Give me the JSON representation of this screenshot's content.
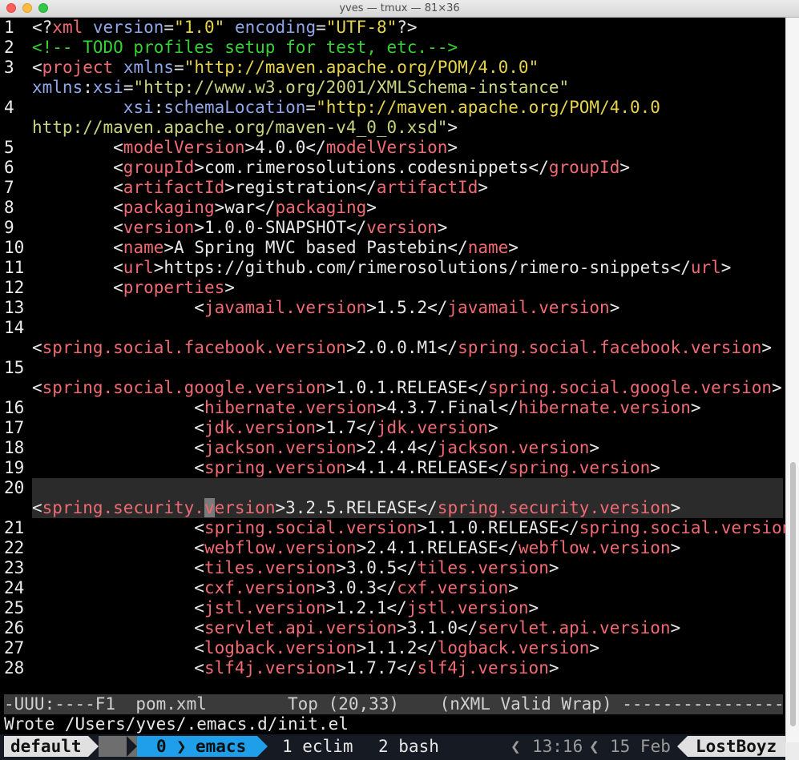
{
  "window": {
    "title": "yves — tmux — 81×36"
  },
  "editor": {
    "rows": [
      {
        "ln": "1",
        "tokens": [
          [
            "punct",
            "<?"
          ],
          [
            "pi",
            "xml"
          ],
          [
            "punct",
            " "
          ],
          [
            "attr",
            "version"
          ],
          [
            "punct",
            "="
          ],
          [
            "str",
            "\"1.0\""
          ],
          [
            "punct",
            " "
          ],
          [
            "attr",
            "encoding"
          ],
          [
            "punct",
            "="
          ],
          [
            "str",
            "\"UTF-8\""
          ],
          [
            "punct",
            "?>"
          ]
        ]
      },
      {
        "ln": "2",
        "tokens": [
          [
            "comment",
            "<!-- TODO profiles setup for test, etc.-->"
          ]
        ]
      },
      {
        "ln": "3",
        "tokens": [
          [
            "punct",
            "<"
          ],
          [
            "tag",
            "project"
          ],
          [
            "punct",
            " "
          ],
          [
            "attr",
            "xmlns"
          ],
          [
            "punct",
            "="
          ],
          [
            "str",
            "\"http://maven.apache.org/POM/4.0.0\""
          ]
        ]
      },
      {
        "ln": "",
        "tokens": [
          [
            "attr",
            "xmlns"
          ],
          [
            "punct",
            ":"
          ],
          [
            "attr",
            "xsi"
          ],
          [
            "punct",
            "="
          ],
          [
            "strg",
            "\"http://www.w3.org/2001/XMLSchema-instance\""
          ]
        ]
      },
      {
        "ln": "4",
        "tokens": [
          [
            "punct",
            "         "
          ],
          [
            "attr",
            "xsi"
          ],
          [
            "punct",
            ":"
          ],
          [
            "attr",
            "schemaLocation"
          ],
          [
            "punct",
            "="
          ],
          [
            "str",
            "\"http://maven.apache.org/POM/4.0.0"
          ]
        ]
      },
      {
        "ln": "",
        "tokens": [
          [
            "strg",
            "http://maven.apache.org/maven-v4_0_0.xsd\""
          ],
          [
            "punct",
            ">"
          ]
        ]
      },
      {
        "ln": "5",
        "tokens": [
          [
            "punct",
            "        <"
          ],
          [
            "tag",
            "modelVersion"
          ],
          [
            "punct",
            ">"
          ],
          [
            "text",
            "4.0.0"
          ],
          [
            "punct",
            "</"
          ],
          [
            "tag",
            "modelVersion"
          ],
          [
            "punct",
            ">"
          ]
        ]
      },
      {
        "ln": "6",
        "tokens": [
          [
            "punct",
            "        <"
          ],
          [
            "tag",
            "groupId"
          ],
          [
            "punct",
            ">"
          ],
          [
            "text",
            "com.rimerosolutions.codesnippets"
          ],
          [
            "punct",
            "</"
          ],
          [
            "tag",
            "groupId"
          ],
          [
            "punct",
            ">"
          ]
        ]
      },
      {
        "ln": "7",
        "tokens": [
          [
            "punct",
            "        <"
          ],
          [
            "tag",
            "artifactId"
          ],
          [
            "punct",
            ">"
          ],
          [
            "text",
            "registration"
          ],
          [
            "punct",
            "</"
          ],
          [
            "tag",
            "artifactId"
          ],
          [
            "punct",
            ">"
          ]
        ]
      },
      {
        "ln": "8",
        "tokens": [
          [
            "punct",
            "        <"
          ],
          [
            "tag",
            "packaging"
          ],
          [
            "punct",
            ">"
          ],
          [
            "text",
            "war"
          ],
          [
            "punct",
            "</"
          ],
          [
            "tag",
            "packaging"
          ],
          [
            "punct",
            ">"
          ]
        ]
      },
      {
        "ln": "9",
        "tokens": [
          [
            "punct",
            "        <"
          ],
          [
            "tag",
            "version"
          ],
          [
            "punct",
            ">"
          ],
          [
            "text",
            "1.0.0-SNAPSHOT"
          ],
          [
            "punct",
            "</"
          ],
          [
            "tag",
            "version"
          ],
          [
            "punct",
            ">"
          ]
        ]
      },
      {
        "ln": "10",
        "tokens": [
          [
            "punct",
            "        <"
          ],
          [
            "tag",
            "name"
          ],
          [
            "punct",
            ">"
          ],
          [
            "text",
            "A Spring MVC based Pastebin"
          ],
          [
            "punct",
            "</"
          ],
          [
            "tag",
            "name"
          ],
          [
            "punct",
            ">"
          ]
        ]
      },
      {
        "ln": "11",
        "tokens": [
          [
            "punct",
            "        <"
          ],
          [
            "tag",
            "url"
          ],
          [
            "punct",
            ">"
          ],
          [
            "text",
            "https://github.com/rimerosolutions/rimero-snippets"
          ],
          [
            "punct",
            "</"
          ],
          [
            "tag",
            "url"
          ],
          [
            "punct",
            ">"
          ]
        ]
      },
      {
        "ln": "12",
        "tokens": [
          [
            "punct",
            "        <"
          ],
          [
            "tag",
            "properties"
          ],
          [
            "punct",
            ">"
          ]
        ]
      },
      {
        "ln": "13",
        "tokens": [
          [
            "punct",
            "                <"
          ],
          [
            "tag",
            "javamail.version"
          ],
          [
            "punct",
            ">"
          ],
          [
            "text",
            "1.5.2"
          ],
          [
            "punct",
            "</"
          ],
          [
            "tag",
            "javamail.version"
          ],
          [
            "punct",
            ">"
          ]
        ]
      },
      {
        "ln": "14",
        "tokens": []
      },
      {
        "ln": "",
        "tokens": [
          [
            "punct",
            "<"
          ],
          [
            "tag",
            "spring.social.facebook.version"
          ],
          [
            "punct",
            ">"
          ],
          [
            "text",
            "2.0.0.M1"
          ],
          [
            "punct",
            "</"
          ],
          [
            "tag",
            "spring.social.facebook.version"
          ],
          [
            "punct",
            ">"
          ]
        ]
      },
      {
        "ln": "15",
        "tokens": []
      },
      {
        "ln": "",
        "tokens": [
          [
            "punct",
            "<"
          ],
          [
            "tag",
            "spring.social.google.version"
          ],
          [
            "punct",
            ">"
          ],
          [
            "text",
            "1.0.1.RELEASE"
          ],
          [
            "punct",
            "</"
          ],
          [
            "tag",
            "spring.social.google.version"
          ],
          [
            "punct",
            ">"
          ]
        ]
      },
      {
        "ln": "16",
        "tokens": [
          [
            "punct",
            "                <"
          ],
          [
            "tag",
            "hibernate.version"
          ],
          [
            "punct",
            ">"
          ],
          [
            "text",
            "4.3.7.Final"
          ],
          [
            "punct",
            "</"
          ],
          [
            "tag",
            "hibernate.version"
          ],
          [
            "punct",
            ">"
          ]
        ]
      },
      {
        "ln": "17",
        "tokens": [
          [
            "punct",
            "                <"
          ],
          [
            "tag",
            "jdk.version"
          ],
          [
            "punct",
            ">"
          ],
          [
            "text",
            "1.7"
          ],
          [
            "punct",
            "</"
          ],
          [
            "tag",
            "jdk.version"
          ],
          [
            "punct",
            ">"
          ]
        ]
      },
      {
        "ln": "18",
        "tokens": [
          [
            "punct",
            "                <"
          ],
          [
            "tag",
            "jackson.version"
          ],
          [
            "punct",
            ">"
          ],
          [
            "text",
            "2.4.4"
          ],
          [
            "punct",
            "</"
          ],
          [
            "tag",
            "jackson.version"
          ],
          [
            "punct",
            ">"
          ]
        ]
      },
      {
        "ln": "19",
        "tokens": [
          [
            "punct",
            "                <"
          ],
          [
            "tag",
            "spring.version"
          ],
          [
            "punct",
            ">"
          ],
          [
            "text",
            "4.1.4.RELEASE"
          ],
          [
            "punct",
            "</"
          ],
          [
            "tag",
            "spring.version"
          ],
          [
            "punct",
            ">"
          ]
        ]
      },
      {
        "ln": "20",
        "tokens": [],
        "current": true
      },
      {
        "ln": "",
        "tokens": [
          [
            "punct",
            "<"
          ],
          [
            "tag",
            "spring.security."
          ],
          [
            "cursor",
            "v"
          ],
          [
            "tag",
            "ersion"
          ],
          [
            "punct",
            ">"
          ],
          [
            "text",
            "3.2.5.RELEASE"
          ],
          [
            "punct",
            "</"
          ],
          [
            "tag",
            "spring.security.version"
          ],
          [
            "punct",
            ">"
          ]
        ],
        "current": true
      },
      {
        "ln": "21",
        "tokens": [
          [
            "punct",
            "                <"
          ],
          [
            "tag",
            "spring.social.version"
          ],
          [
            "punct",
            ">"
          ],
          [
            "text",
            "1.1.0.RELEASE"
          ],
          [
            "punct",
            "</"
          ],
          [
            "tag",
            "spring.social.version"
          ],
          [
            "punct",
            ">"
          ]
        ]
      },
      {
        "ln": "22",
        "tokens": [
          [
            "punct",
            "                <"
          ],
          [
            "tag",
            "webflow.version"
          ],
          [
            "punct",
            ">"
          ],
          [
            "text",
            "2.4.1.RELEASE"
          ],
          [
            "punct",
            "</"
          ],
          [
            "tag",
            "webflow.version"
          ],
          [
            "punct",
            ">"
          ]
        ]
      },
      {
        "ln": "23",
        "tokens": [
          [
            "punct",
            "                <"
          ],
          [
            "tag",
            "tiles.version"
          ],
          [
            "punct",
            ">"
          ],
          [
            "text",
            "3.0.5"
          ],
          [
            "punct",
            "</"
          ],
          [
            "tag",
            "tiles.version"
          ],
          [
            "punct",
            ">"
          ]
        ]
      },
      {
        "ln": "24",
        "tokens": [
          [
            "punct",
            "                <"
          ],
          [
            "tag",
            "cxf.version"
          ],
          [
            "punct",
            ">"
          ],
          [
            "text",
            "3.0.3"
          ],
          [
            "punct",
            "</"
          ],
          [
            "tag",
            "cxf.version"
          ],
          [
            "punct",
            ">"
          ]
        ]
      },
      {
        "ln": "25",
        "tokens": [
          [
            "punct",
            "                <"
          ],
          [
            "tag",
            "jstl.version"
          ],
          [
            "punct",
            ">"
          ],
          [
            "text",
            "1.2.1"
          ],
          [
            "punct",
            "</"
          ],
          [
            "tag",
            "jstl.version"
          ],
          [
            "punct",
            ">"
          ]
        ]
      },
      {
        "ln": "26",
        "tokens": [
          [
            "punct",
            "                <"
          ],
          [
            "tag",
            "servlet.api.version"
          ],
          [
            "punct",
            ">"
          ],
          [
            "text",
            "3.1.0"
          ],
          [
            "punct",
            "</"
          ],
          [
            "tag",
            "servlet.api.version"
          ],
          [
            "punct",
            ">"
          ]
        ]
      },
      {
        "ln": "27",
        "tokens": [
          [
            "punct",
            "                <"
          ],
          [
            "tag",
            "logback.version"
          ],
          [
            "punct",
            ">"
          ],
          [
            "text",
            "1.1.2"
          ],
          [
            "punct",
            "</"
          ],
          [
            "tag",
            "logback.version"
          ],
          [
            "punct",
            ">"
          ]
        ]
      },
      {
        "ln": "28",
        "tokens": [
          [
            "punct",
            "                <"
          ],
          [
            "tag",
            "slf4j.version"
          ],
          [
            "punct",
            ">"
          ],
          [
            "text",
            "1.7.7"
          ],
          [
            "punct",
            "</"
          ],
          [
            "tag",
            "slf4j.version"
          ],
          [
            "punct",
            ">"
          ]
        ]
      }
    ]
  },
  "modeline": {
    "text": "-UUU:----F1  pom.xml        Top (20,33)    (nXML Valid Wrap) ------------------------"
  },
  "minibuffer": {
    "text": "Wrote /Users/yves/.emacs.d/init.el"
  },
  "tmux": {
    "session": "default",
    "active_index": "0",
    "active_sep": "❯",
    "active_name": "emacs",
    "window1": "1 eclim",
    "window2": "2 bash",
    "sep_left": "❮",
    "time": "13:16",
    "date": "15 Feb",
    "host": "LostBoyz"
  },
  "colors": {
    "tag": "#f06a73",
    "attr": "#8fa6e8",
    "string": "#e5d34a",
    "comment": "#36d134",
    "tmux_active": "#1f9eea"
  }
}
